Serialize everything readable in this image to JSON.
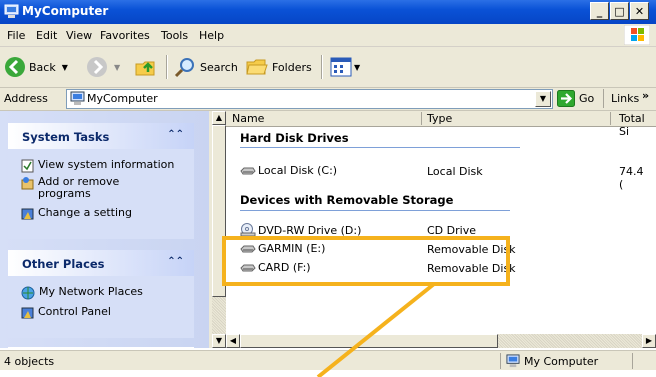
{
  "window": {
    "title": "MyComputer"
  },
  "menu": [
    "File",
    "Edit",
    "View",
    "Favorites",
    "Tools",
    "Help"
  ],
  "toolbar": {
    "back": "Back",
    "search": "Search",
    "folders": "Folders"
  },
  "address": {
    "label": "Address",
    "value": "MyComputer",
    "go": "Go",
    "links": "Links",
    "links_chevron": "»"
  },
  "tasks": {
    "system": {
      "title": "System Tasks",
      "items": [
        "View system information",
        "Add or remove programs",
        "Change a setting"
      ]
    },
    "places": {
      "title": "Other Places",
      "items": [
        "My Network Places",
        "Control Panel"
      ]
    }
  },
  "columns": [
    "Name",
    "Type",
    "Total Si"
  ],
  "groups": {
    "hdd": {
      "title": "Hard Disk Drives",
      "rows": [
        {
          "name": "Local Disk (C:)",
          "type": "Local Disk",
          "size": "74.4 ("
        }
      ]
    },
    "removable": {
      "title": "Devices with Removable Storage",
      "rows": [
        {
          "name": "DVD-RW Drive (D:)",
          "type": "CD Drive"
        },
        {
          "name": "GARMIN (E:)",
          "type": "Removable Disk"
        },
        {
          "name": "CARD (F:)",
          "type": "Removable Disk"
        }
      ]
    }
  },
  "status": {
    "count": "4 objects",
    "location": "My Computer"
  },
  "colors": {
    "title_blue": "#0a52d6",
    "highlight": "#f5b21d",
    "pane_blue": "#d6dff7"
  }
}
